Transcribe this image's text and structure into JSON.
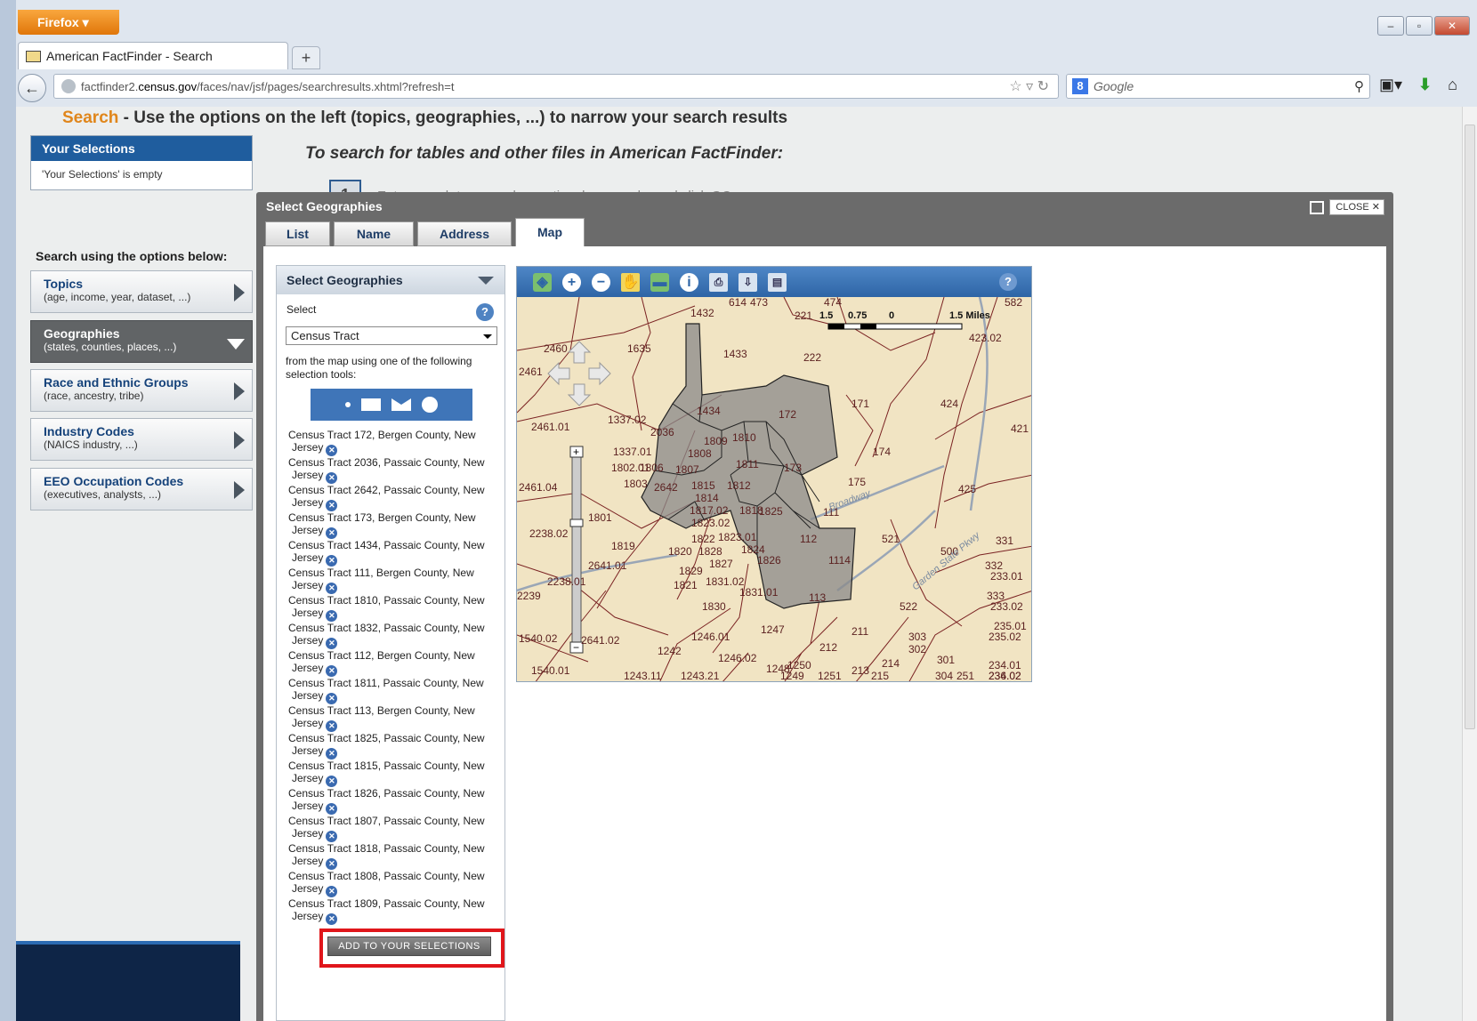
{
  "browser": {
    "app_button": "Firefox",
    "tab_title": "American FactFinder - Search",
    "url_prefix": "factfinder2.",
    "url_domain": "census.gov",
    "url_path": "/faces/nav/jsf/pages/searchresults.xhtml?refresh=t",
    "search_engine_placeholder": "Google"
  },
  "page": {
    "heading_highlight": "Search",
    "heading_rest": " - Use the options on the left (topics, geographies, ...) to narrow your search results",
    "your_selections": {
      "title": "Your Selections",
      "empty_text": "'Your Selections' is empty"
    },
    "search_title": "To search for tables and other files in American FactFinder:",
    "step_number": "1",
    "step_text": "Enter search terms and an optional geography and click GO",
    "options_label": "Search using the options below:",
    "options": [
      {
        "title": "Topics",
        "sub": "(age, income, year, dataset, ...)"
      },
      {
        "title": "Geographies",
        "sub": "(states, counties, places, ...)"
      },
      {
        "title": "Race and Ethnic Groups",
        "sub": "(race, ancestry, tribe)"
      },
      {
        "title": "Industry Codes",
        "sub": "(NAICS industry, ...)"
      },
      {
        "title": "EEO Occupation Codes",
        "sub": "(executives, analysts, ...)"
      }
    ]
  },
  "modal": {
    "title": "Select Geographies",
    "close_label": "CLOSE",
    "tabs": [
      "List",
      "Name",
      "Address",
      "Map"
    ],
    "active_tab": "Map",
    "panel": {
      "title": "Select Geographies",
      "select_label": "Select",
      "geo_type": "Census Tract",
      "hint": "from the map using one of the following selection tools:",
      "jersey_label": "Jersey",
      "add_button": "ADD TO YOUR SELECTIONS",
      "selections": [
        "Census Tract 172, Bergen County, New",
        "Census Tract 2036, Passaic County, New",
        "Census Tract 2642, Passaic County, New",
        "Census Tract 173, Bergen County, New",
        "Census Tract 1434, Passaic County, New",
        "Census Tract 111, Bergen County, New",
        "Census Tract 1810, Passaic County, New",
        "Census Tract 1832, Passaic County, New",
        "Census Tract 112, Bergen County, New",
        "Census Tract 1811, Passaic County, New",
        "Census Tract 113, Bergen County, New",
        "Census Tract 1825, Passaic County, New",
        "Census Tract 1815, Passaic County, New",
        "Census Tract 1826, Passaic County, New",
        "Census Tract 1807, Passaic County, New",
        "Census Tract 1818, Passaic County, New",
        "Census Tract 1808, Passaic County, New",
        "Census Tract 1809, Passaic County, New"
      ]
    },
    "map": {
      "scale_labels": [
        "1.5",
        "0.75",
        "0",
        "1.5 Miles"
      ],
      "labels": [
        "614",
        "473",
        "1432",
        "221",
        "474",
        "582",
        "423.02",
        "2460",
        "1635",
        "1433",
        "222",
        "2461",
        "1434",
        "172",
        "171",
        "424",
        "2461.01",
        "1337.02",
        "2036",
        "1809",
        "1810",
        "421",
        "1337.01",
        "1808",
        "1811",
        "173",
        "174",
        "1802.01",
        "1806",
        "1807",
        "1812",
        "175",
        "425",
        "2461.04",
        "1803",
        "2642",
        "1815",
        "1814",
        "1825",
        "111",
        "1801",
        "1817.02",
        "1818",
        "1823.02",
        "2238.02",
        "1819",
        "1822",
        "1823.01",
        "112",
        "521",
        "331",
        "1820",
        "1828",
        "1824",
        "1826",
        "1114",
        "500",
        "2641.01",
        "1827",
        "332",
        "233.01",
        "2238.01",
        "1829",
        "1821",
        "1831.02",
        "2239",
        "1831.01",
        "113",
        "333",
        "1830",
        "522",
        "233.02",
        "1247",
        "211",
        "235.01",
        "1540.02",
        "2641.02",
        "1246.01",
        "212",
        "303",
        "235.02",
        "1242",
        "1246.02",
        "302",
        "301",
        "234.01",
        "1540.01",
        "1248",
        "1250",
        "213",
        "214",
        "234.02",
        "1243.11",
        "1243.21",
        "1249",
        "1251",
        "215",
        "304",
        "251",
        "236.02"
      ],
      "road_labels": [
        "Broadway",
        "Garden State Pkwy"
      ]
    }
  }
}
